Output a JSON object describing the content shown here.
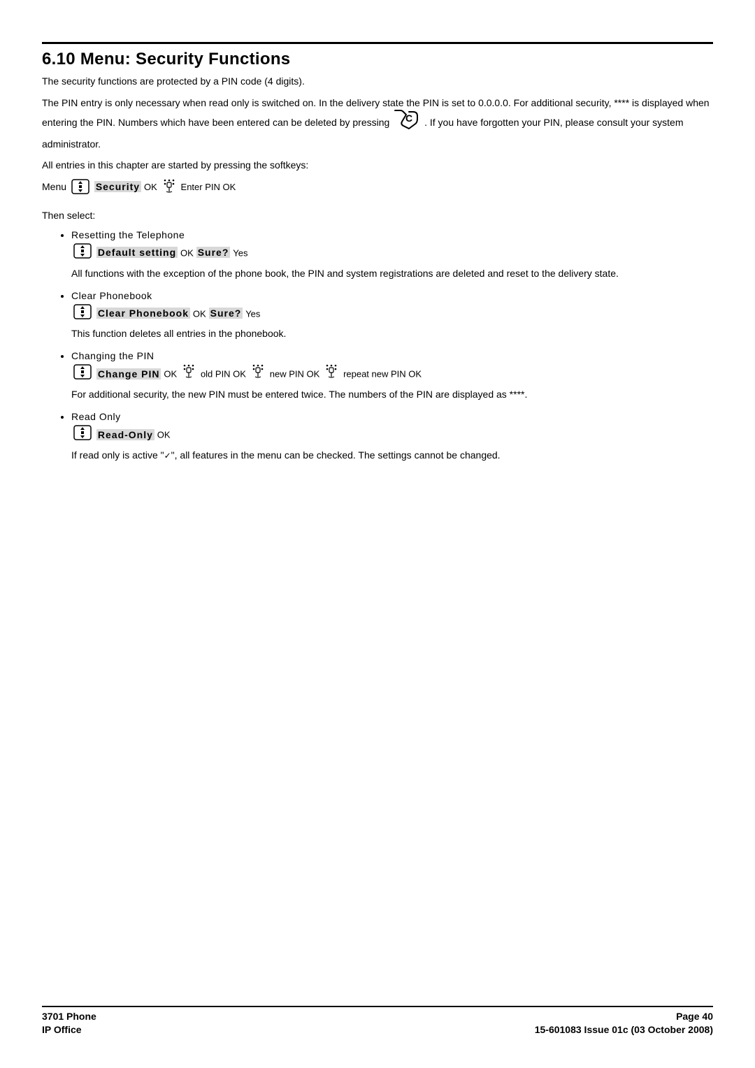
{
  "section": {
    "number": "6.10",
    "title": "Menu: Security Functions"
  },
  "intro": {
    "p1": "The security functions are protected by a PIN code (4 digits).",
    "p2a": "The PIN entry is only necessary when read only is switched on. In the delivery state the PIN is set to 0.0.0.0. For additional security, **** is displayed when entering the PIN. Numbers which have been entered can be deleted by pressing ",
    "p2b": ". If you have forgotten your PIN, please consult your system administrator.",
    "p3": "All entries in this chapter are started by pressing the softkeys:"
  },
  "softkey": {
    "menu": "Menu",
    "security": "Security",
    "ok": "OK",
    "enterpin": "Enter PIN OK"
  },
  "then": "Then select:",
  "items": [
    {
      "title": "Resetting the Telephone",
      "label": "Default setting",
      "ok1": "OK",
      "sure": "Sure?",
      "yes": "Yes",
      "desc": "All functions with the exception of the phone book, the PIN and system registrations are deleted and reset to the delivery state."
    },
    {
      "title": "Clear Phonebook",
      "label": "Clear Phonebook",
      "ok1": "OK",
      "sure": "Sure?",
      "yes": "Yes",
      "desc": "This function deletes all entries in the phonebook."
    },
    {
      "title": "Changing the PIN",
      "label": "Change PIN",
      "ok1": "OK",
      "old": "old PIN OK",
      "new": "new PIN OK",
      "repeat": "repeat new PIN OK",
      "desc": "For additional security, the new PIN must be entered twice. The numbers of the PIN are displayed as ****."
    },
    {
      "title": "Read Only",
      "label": "Read-Only",
      "ok1": "OK",
      "desc_a": "If read only is active \"",
      "desc_b": "\", all features in the menu can be checked. The settings cannot be changed."
    }
  ],
  "footer": {
    "left1": "3701 Phone",
    "left2": "IP Office",
    "right1": "Page 40",
    "right2": "15-601083 Issue 01c (03 October 2008)"
  }
}
